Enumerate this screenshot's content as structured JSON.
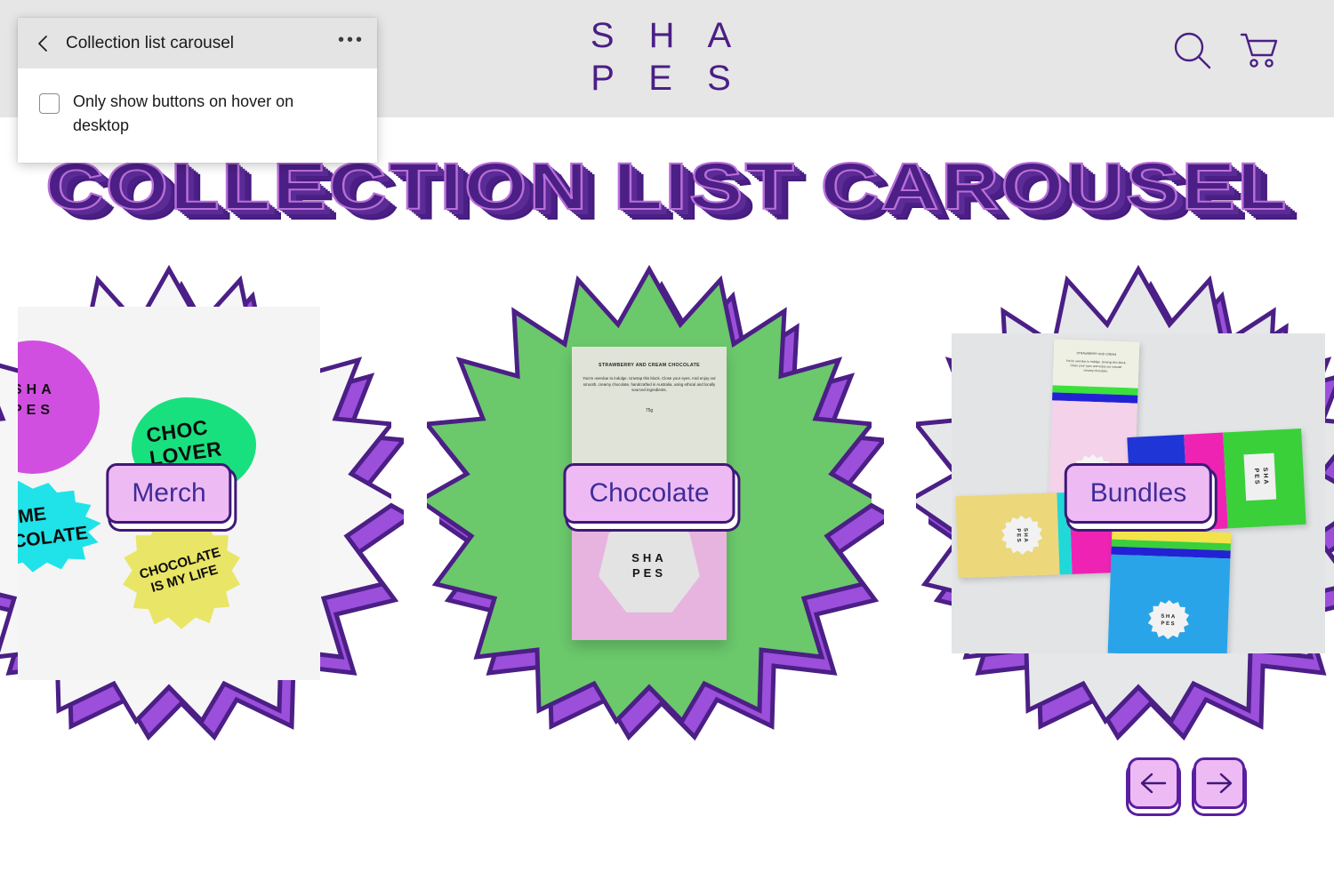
{
  "editor_panel": {
    "back_icon": "chevron-left-icon",
    "title": "Collection list carousel",
    "more_icon": "ellipsis-icon",
    "more_label": "•••",
    "settings": [
      {
        "type": "checkbox",
        "label": "Only show buttons on hover on desktop",
        "checked": false
      }
    ]
  },
  "header": {
    "logo_line1": "S H A",
    "logo_line2": "P E S",
    "search_icon": "search-icon",
    "cart_icon": "shopping-cart-icon",
    "background": "#e6e6e6",
    "brand_color": "#4b1f86"
  },
  "page": {
    "title": "COLLECTION LIST CAROUSEL",
    "title_color": "#4b1f86",
    "title_outline_color": "#b96fd8"
  },
  "carousel": {
    "cards": [
      {
        "label": "Merch",
        "burst_fill": "#f6f6f6",
        "burst_shadow_fill": "#9b4fdb",
        "burst_stroke": "#4b1f86",
        "photo": {
          "kind": "merch-stickers",
          "background": "#f4f4f4",
          "stickers": [
            {
              "name": "sticker-circle-shapes",
              "color": "#d14fe0",
              "text": "SHA\nPES"
            },
            {
              "name": "sticker-blob-choc-lover",
              "color": "#19e07e",
              "text": "CHOC\nLOVER"
            },
            {
              "name": "sticker-burst-give-me-chocolate",
              "color": "#1fe3e8",
              "text": "GIVE ME\nCHOCOLATE"
            },
            {
              "name": "sticker-burst-chocolate-is-my-life",
              "color": "#e9e566",
              "text": "CHOCOLATE\nIS MY LIFE"
            }
          ]
        }
      },
      {
        "label": "Chocolate",
        "burst_fill": "#6bc86b",
        "burst_shadow_fill": "#9b4fdb",
        "burst_stroke": "#4b1f86",
        "photo": {
          "kind": "chocolate-bar",
          "heading": "STRAWBERRY AND CREAM CHOCOLATE",
          "body": "You're overdue to indulge. Unwrap this block. Close your eyes. And enjoy our smooth, creamy chocolate, handcrafted in Australia, using ethical and locally sourced ingredients.",
          "weight": "75g",
          "stripe_green": "#2fd92f",
          "stripe_blue": "#2222d4",
          "panel_pink": "#e7b4df",
          "emblem_text": "SHA\nPES"
        }
      },
      {
        "label": "Bundles",
        "burst_fill": "#e5e7e9",
        "burst_shadow_fill": "#9b4fdb",
        "burst_stroke": "#4b1f86",
        "photo": {
          "kind": "bundle-bars",
          "background": "#e2e4e6",
          "bars": [
            {
              "name": "bar-pink-cream",
              "colors": [
                "#eef0e4",
                "#3be03b",
                "#2222d4",
                "#f3d2ea"
              ],
              "sticker_text": "SHA\nPES"
            },
            {
              "name": "bar-blue-magenta-green",
              "colors": [
                "#1f35d6",
                "#ee23b4",
                "#3ad03a"
              ],
              "label_text": "SHA\nPES"
            },
            {
              "name": "bar-yellow",
              "colors": [
                "#ecd77a",
                "#20d8d8",
                "#ee23b4"
              ],
              "sticker_text": "SHA\nPES"
            },
            {
              "name": "bar-cyan-blue",
              "colors": [
                "#2aa4e8",
                "#3ad03a",
                "#2222d4",
                "#f3e24a"
              ],
              "sticker_text": "SHA\nPES"
            }
          ]
        }
      }
    ],
    "nav": {
      "prev_icon": "arrow-left-icon",
      "next_icon": "arrow-right-icon",
      "prev_label": "Previous slide",
      "next_label": "Next slide"
    }
  }
}
